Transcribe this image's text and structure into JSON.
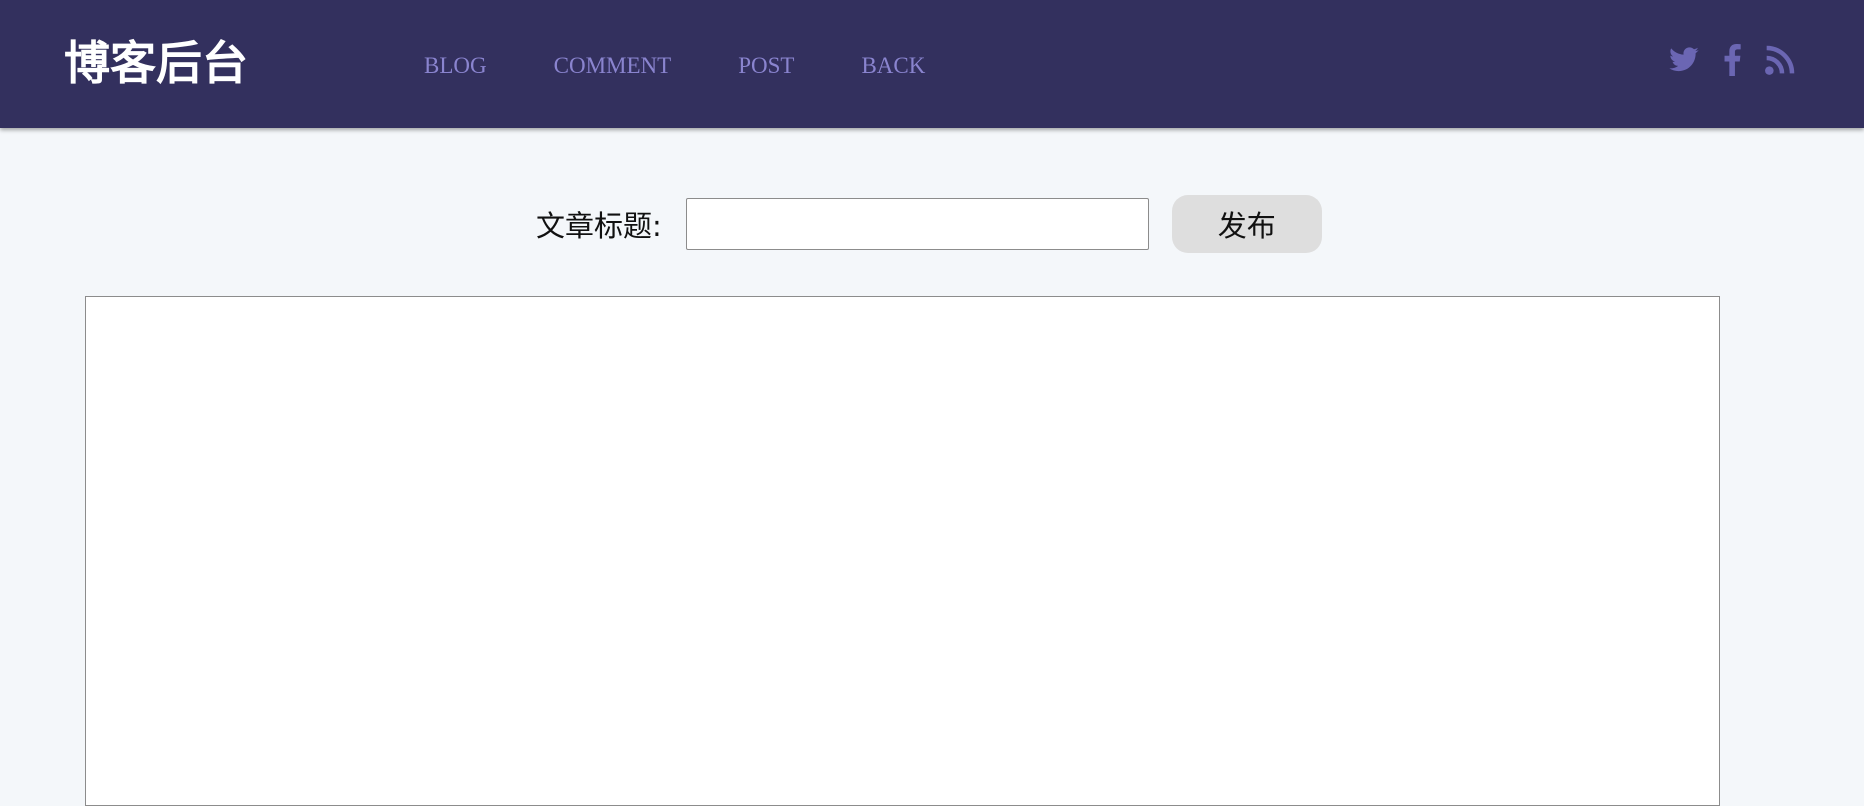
{
  "header": {
    "brand": "博客后台",
    "nav": [
      {
        "label": "BLOG"
      },
      {
        "label": "COMMENT"
      },
      {
        "label": "POST"
      },
      {
        "label": "BACK"
      }
    ],
    "social_icons": [
      "twitter-icon",
      "facebook-icon",
      "rss-icon"
    ],
    "colors": {
      "header_bg": "#33305e",
      "nav_text": "#8a84cf",
      "icon": "#6b66b3"
    }
  },
  "form": {
    "title_label": "文章标题:",
    "title_value": "",
    "publish_label": "发布"
  },
  "editor": {
    "value": ""
  }
}
